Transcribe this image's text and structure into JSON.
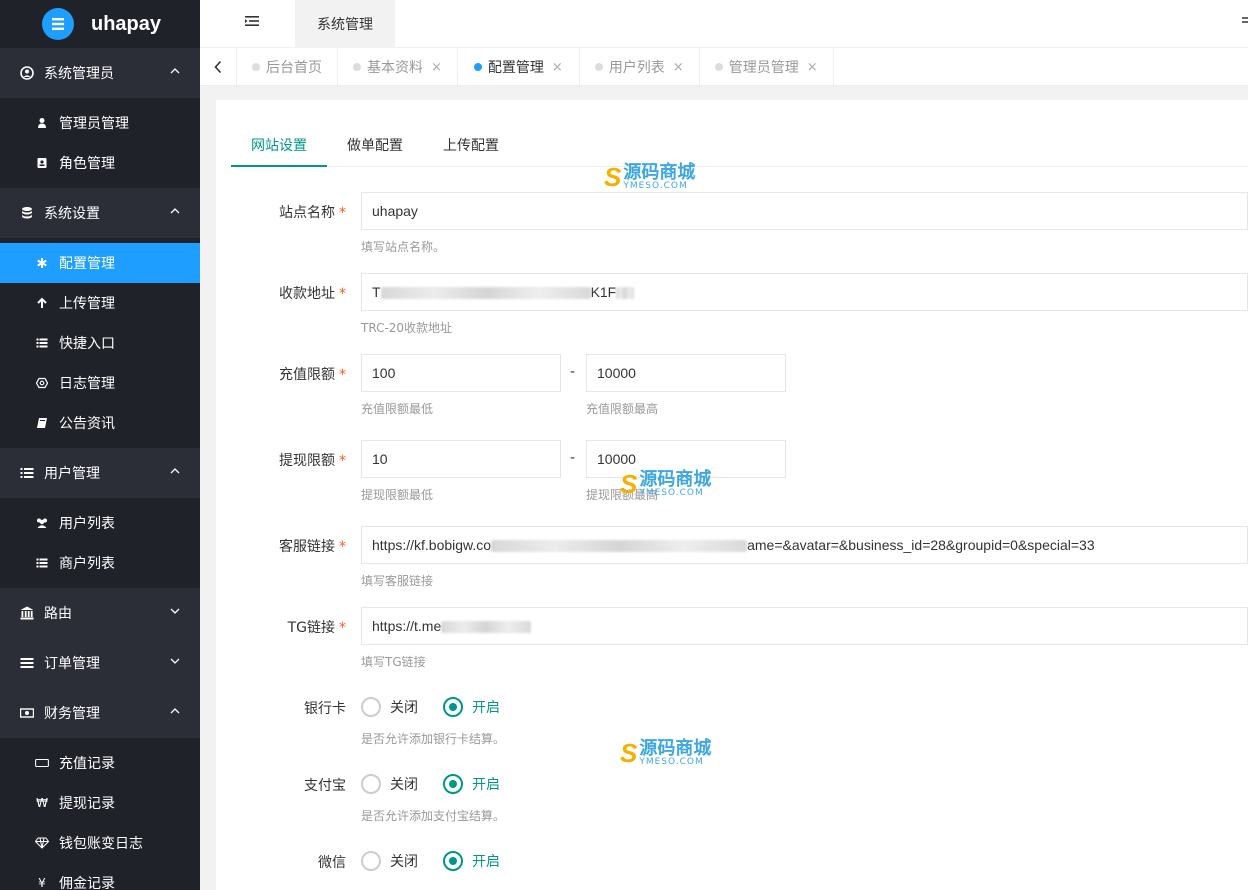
{
  "app": {
    "name": "uhapay",
    "brand_color": "#1e9fff"
  },
  "header": {
    "active_top_tab": "系统管理"
  },
  "sidebar": {
    "groups": [
      {
        "label": "系统管理员",
        "icon": "user-circle-icon",
        "items": [
          {
            "label": "管理员管理",
            "icon": "user-icon"
          },
          {
            "label": "角色管理",
            "icon": "id-card-icon"
          }
        ]
      },
      {
        "label": "系统设置",
        "icon": "database-icon",
        "items": [
          {
            "label": "配置管理",
            "icon": "asterisk-icon",
            "active": true
          },
          {
            "label": "上传管理",
            "icon": "arrow-up-icon"
          },
          {
            "label": "快捷入口",
            "icon": "list-icon"
          },
          {
            "label": "日志管理",
            "icon": "hexagon-icon"
          },
          {
            "label": "公告资讯",
            "icon": "book-icon"
          }
        ]
      },
      {
        "label": "用户管理",
        "icon": "list-icon",
        "items": [
          {
            "label": "用户列表",
            "icon": "users-icon"
          },
          {
            "label": "商户列表",
            "icon": "list-icon"
          }
        ]
      },
      {
        "label": "路由",
        "icon": "bank-icon"
      },
      {
        "label": "订单管理",
        "icon": "bars-icon"
      },
      {
        "label": "财务管理",
        "icon": "money-icon",
        "items": [
          {
            "label": "充值记录",
            "icon": "card-icon"
          },
          {
            "label": "提现记录",
            "icon": "won-icon"
          },
          {
            "label": "钱包账变日志",
            "icon": "diamond-icon"
          },
          {
            "label": "佣金记录",
            "icon": "yen-icon"
          }
        ]
      }
    ]
  },
  "tabs": [
    {
      "label": "后台首页"
    },
    {
      "label": "基本资料",
      "close": "×"
    },
    {
      "label": "配置管理",
      "close": "×",
      "active": true
    },
    {
      "label": "用户列表",
      "close": "×"
    },
    {
      "label": "管理员管理",
      "close": "×"
    }
  ],
  "content_tabs": [
    "网站设置",
    "做单配置",
    "上传配置"
  ],
  "form": {
    "site_name": {
      "label": "站点名称",
      "value": "uhapay",
      "hint": "填写站点名称。"
    },
    "address": {
      "label": "收款地址",
      "value_start": "T",
      "value_end": "K1F",
      "hint": "TRC-20收款地址"
    },
    "recharge": {
      "label": "充值限额",
      "min": "100",
      "max": "10000",
      "hint_min": "充值限额最低",
      "hint_max": "充值限额最高"
    },
    "withdraw": {
      "label": "提现限额",
      "min": "10",
      "max": "10000",
      "hint_min": "提现限额最低",
      "hint_max": "提现限额最高"
    },
    "service": {
      "label": "客服链接",
      "value_start": "https://kf.bobigw.co",
      "value_end": "ame=&avatar=&business_id=28&groupid=0&special=33",
      "hint": "填写客服链接"
    },
    "tg": {
      "label": "TG链接",
      "value_start": "https://t.me",
      "hint": "填写TG链接"
    },
    "bank": {
      "label": "银行卡",
      "off": "关闭",
      "on": "开启",
      "hint": "是否允许添加银行卡结算。"
    },
    "alipay": {
      "label": "支付宝",
      "off": "关闭",
      "on": "开启",
      "hint": "是否允许添加支付宝结算。"
    },
    "wechat": {
      "label": "微信",
      "off": "关闭",
      "on": "开启"
    }
  },
  "required_mark": "*",
  "range_dash": "-",
  "watermark": {
    "cn": "源码商城",
    "en": "YMESO.COM",
    "s": "S"
  }
}
